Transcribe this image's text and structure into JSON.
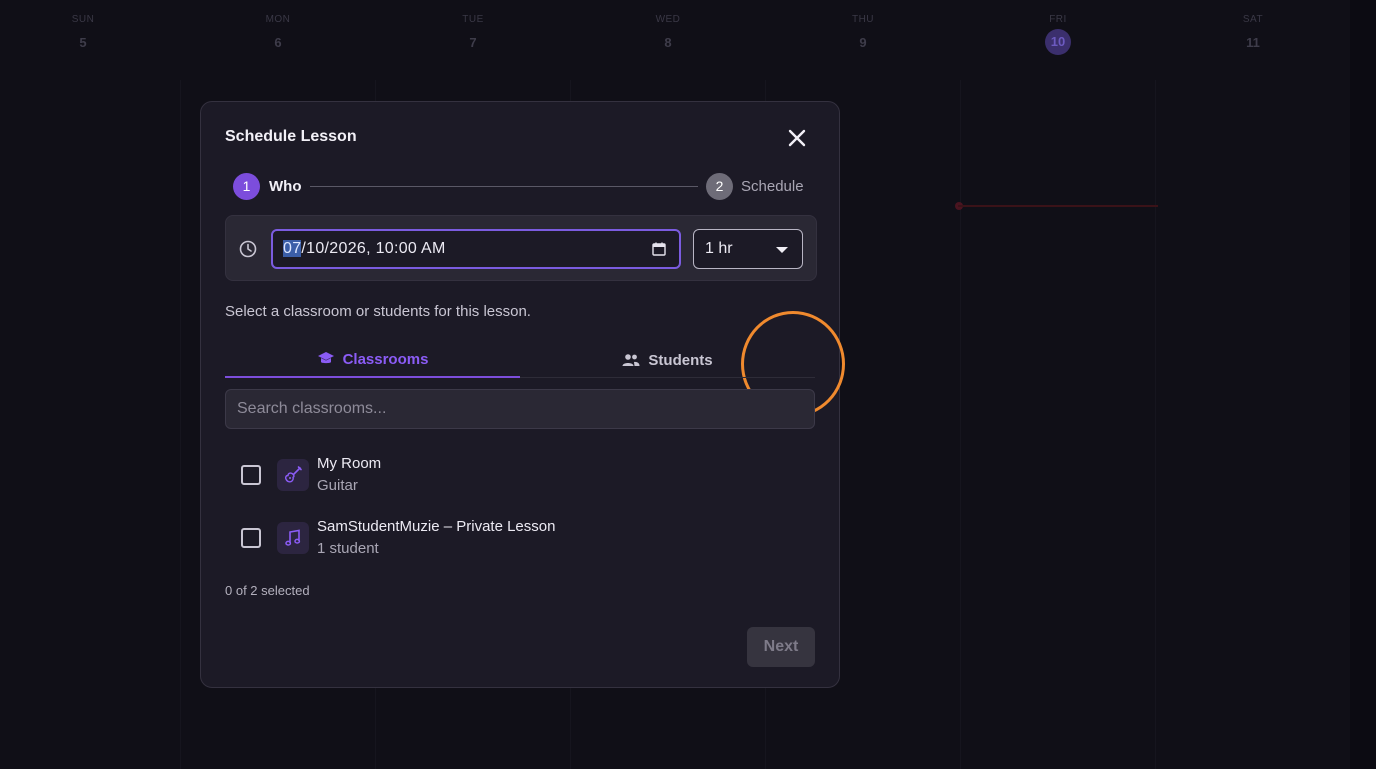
{
  "calendar": {
    "days": [
      {
        "name": "SUN",
        "num": "5"
      },
      {
        "name": "MON",
        "num": "6"
      },
      {
        "name": "TUE",
        "num": "7"
      },
      {
        "name": "WED",
        "num": "8"
      },
      {
        "name": "THU",
        "num": "9"
      },
      {
        "name": "FRI",
        "num": "10"
      },
      {
        "name": "SAT",
        "num": "11"
      }
    ]
  },
  "modal": {
    "title": "Schedule Lesson",
    "steps": [
      {
        "number": "1",
        "label": "Who"
      },
      {
        "number": "2",
        "label": "Schedule"
      }
    ],
    "datetime": {
      "month": "07",
      "rest": "/10/2026, 10:00 AM"
    },
    "duration": {
      "selected": "1 hr"
    },
    "helper_text": "Select a classroom or students for this lesson.",
    "tabs": [
      {
        "label": "Classrooms",
        "icon": "graduation-cap-icon"
      },
      {
        "label": "Students",
        "icon": "people-icon"
      }
    ],
    "search": {
      "placeholder": "Search classrooms..."
    },
    "items": [
      {
        "title": "My Room",
        "subtitle": "Guitar",
        "icon": "guitar-icon"
      },
      {
        "title": "SamStudentMuzie – Private Lesson",
        "subtitle": "1 student",
        "icon": "music-note-icon"
      }
    ],
    "selection_count": "0 of 2 selected",
    "next_label": "Next"
  },
  "colors": {
    "accent": "#7c4ddc",
    "highlight_ring": "#f08a2e"
  }
}
